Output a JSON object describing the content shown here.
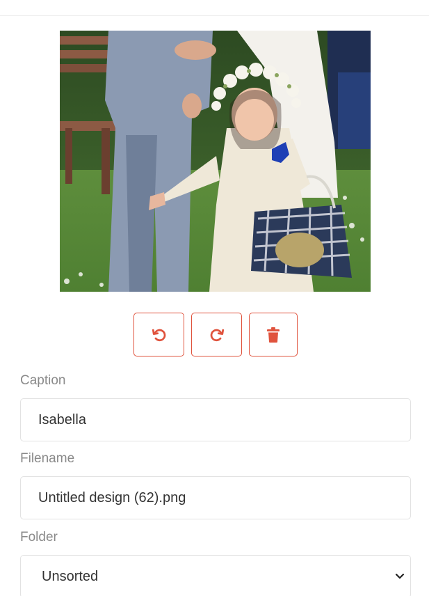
{
  "photo": {
    "alt": "Girl with flower crown carrying a gingham basket"
  },
  "toolbar": {
    "rotate_left_icon": "rotate-ccw",
    "rotate_right_icon": "rotate-cw",
    "delete_icon": "trash",
    "accent_color": "#e0533d"
  },
  "form": {
    "caption_label": "Caption",
    "caption_value": "Isabella",
    "filename_label": "Filename",
    "filename_value": "Untitled design (62).png",
    "folder_label": "Folder",
    "folder_value": "Unsorted"
  }
}
